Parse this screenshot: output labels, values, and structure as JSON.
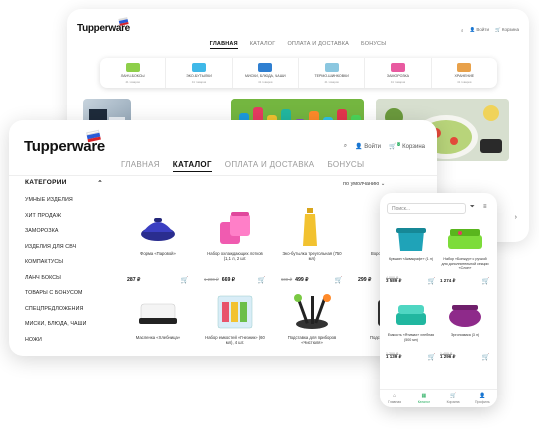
{
  "colors": {
    "accent": "#27ae60",
    "text": "#111111",
    "muted": "#999999"
  },
  "back": {
    "logo": "Tupperware",
    "util": {
      "login": "Войти",
      "cart": "Корзина"
    },
    "nav": [
      "ГЛАВНАЯ",
      "КАТАЛОГ",
      "ОПЛАТА И ДОСТАВКА",
      "БОНУСЫ"
    ],
    "categories": [
      {
        "label": "ЛАНЧ-БОКСЫ",
        "sub": "41 товаров",
        "color": "#8ecf4a"
      },
      {
        "label": "ЭКО-БУТЫЛКИ",
        "sub": "41 товаров",
        "color": "#3fb8e8"
      },
      {
        "label": "МИСКИ, БЛЮДА, ЧАШИ",
        "sub": "41 товаров",
        "color": "#2f7fd1"
      },
      {
        "label": "ТЕРМО-ШИНКОВКИ",
        "sub": "41 товаров",
        "color": "#8bc7e0"
      },
      {
        "label": "ЗАМОРОЗКА",
        "sub": "41 товаров",
        "color": "#e85aa0"
      },
      {
        "label": "ХРАНЕНИЕ",
        "sub": "41 товаров",
        "color": "#e8a14a"
      }
    ],
    "arrow": "›"
  },
  "front": {
    "logo": "Tupperware",
    "util": {
      "search": "⌕",
      "login": "Войти",
      "cart": "Корзина",
      "cart_count": "0"
    },
    "nav": [
      "ГЛАВНАЯ",
      "КАТАЛОГ",
      "ОПЛАТА И ДОСТАВКА",
      "БОНУСЫ"
    ],
    "sort": "по умолчанию",
    "sidebar_title": "КАТЕГОРИИ",
    "sidebar": [
      "УМНЫЕ ИЗДЕЛИЯ",
      "ХИТ ПРОДАЖ",
      "ЗАМОРОЗКА",
      "ИЗДЕЛИЯ ДЛЯ СВЧ",
      "КОМПАКТУСЫ",
      "ЛАНЧ БОКСЫ",
      "ТОВАРЫ С БОНУСОМ",
      "СПЕЦПРЕДЛОЖЕНИЯ",
      "МИСКИ, БЛЮДА, ЧАШИ",
      "НОЖИ"
    ],
    "products_row1": [
      {
        "name": "Форма «Паровой»",
        "old": "",
        "price": "287 ₽"
      },
      {
        "name": "Набор охлаждающих лотков (1,1 л, 2 шт.",
        "old": "1 200 ₽",
        "price": "669 ₽"
      },
      {
        "name": "Эко-бутылка треугольная (750 мл)",
        "old": "600 ₽",
        "price": "499 ₽"
      },
      {
        "name": "Воронка «Стакан»",
        "old": "",
        "price": "299 ₽"
      }
    ],
    "products_row2": [
      {
        "name": "Масленка «Хлебница»"
      },
      {
        "name": "Набор емкостей «Гнезник» (60 мл), 4 шт."
      },
      {
        "name": "Подставка для приборов «Чистюля»"
      },
      {
        "name": "Подставка для пр..."
      }
    ]
  },
  "phone": {
    "search_placeholder": "Поиск...",
    "cards": [
      {
        "name": "Кувшин «Аквакрафт» (1 л)",
        "old": "4 000 ₽",
        "price": "3 589 ₽"
      },
      {
        "name": "Набор «Бонжур» с ручкой для дополнительной секции «Слон»",
        "old": "",
        "price": "1 274 ₽"
      },
      {
        "name": "Емкость «Ятимах» хлебная (500 мл)",
        "old": "1 200 ₽",
        "price": "1 139 ₽"
      },
      {
        "name": "Эргономика (3 л)",
        "old": "1 400 ₽",
        "price": "1 296 ₽"
      }
    ],
    "tabs": [
      "Главная",
      "Каталог",
      "Корзина",
      "Профиль"
    ]
  }
}
